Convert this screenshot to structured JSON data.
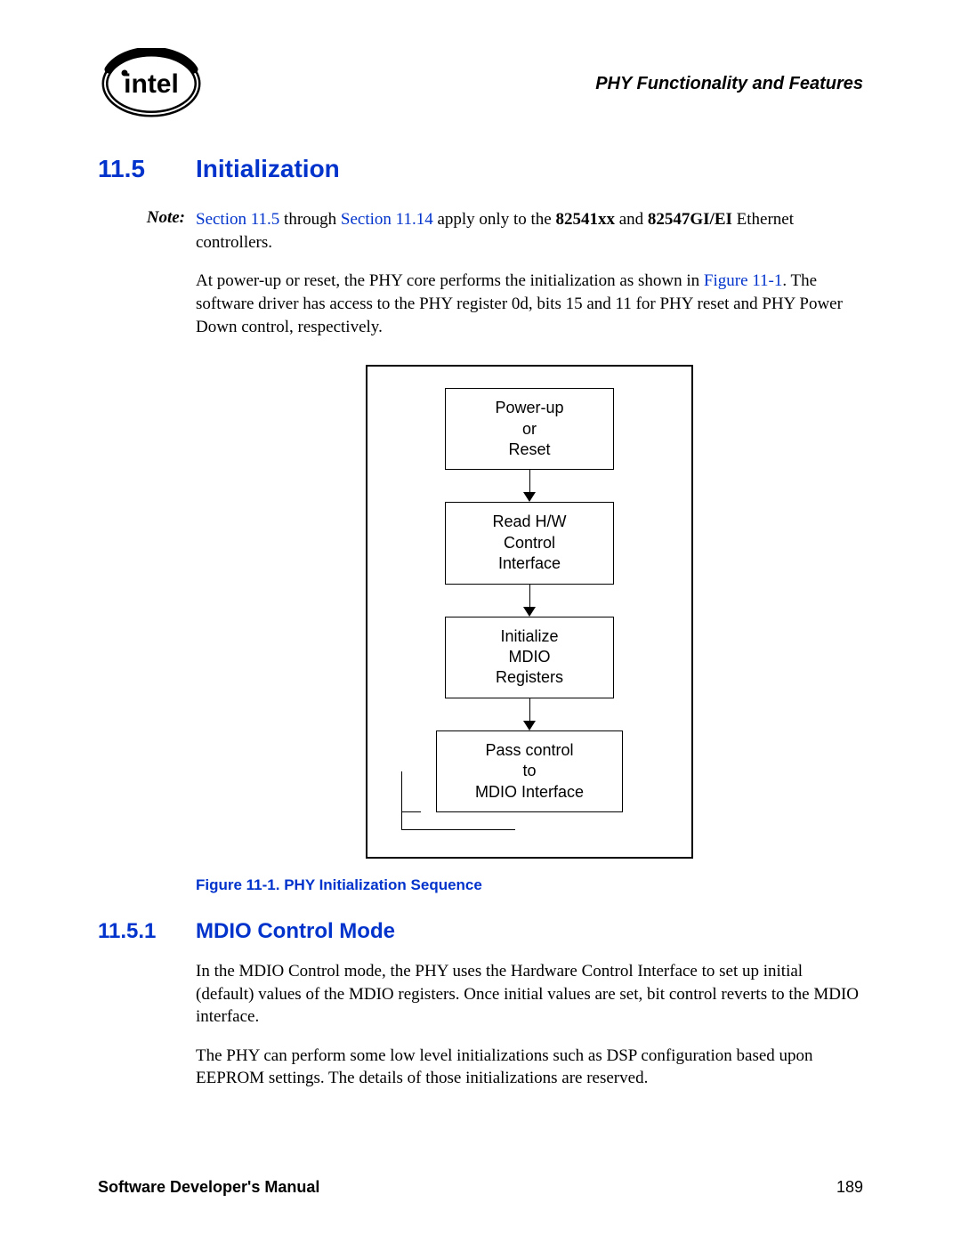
{
  "header": {
    "chapter_title": "PHY Functionality and Features"
  },
  "section": {
    "number": "11.5",
    "title": "Initialization"
  },
  "note": {
    "label": "Note:",
    "link1": "Section 11.5",
    "mid1": " through ",
    "link2": "Section 11.14",
    "mid2": " apply only to the ",
    "bold1": "82541xx",
    "mid3": " and ",
    "bold2": "82547GI/EI",
    "tail": " Ethernet controllers."
  },
  "para1": {
    "pre": "At power-up or reset, the PHY core performs the initialization as shown in ",
    "link": "Figure 11-1",
    "post": ". The software driver has access to the PHY register 0d, bits 15 and 11 for PHY reset and PHY Power Down control, respectively."
  },
  "figure": {
    "box1_l1": "Power-up",
    "box1_l2": "or",
    "box1_l3": "Reset",
    "box2_l1": "Read H/W",
    "box2_l2": "Control",
    "box2_l3": "Interface",
    "box3_l1": "Initialize",
    "box3_l2": "MDIO",
    "box3_l3": "Registers",
    "box4_l1": "Pass control",
    "box4_l2": "to",
    "box4_l3": "MDIO Interface",
    "caption": "Figure 11-1. PHY Initialization Sequence"
  },
  "subsection": {
    "number": "11.5.1",
    "title": "MDIO Control Mode"
  },
  "para2": "In the MDIO Control mode, the PHY uses the Hardware Control Interface to set up initial (default) values of the MDIO registers. Once initial values are set, bit control reverts to the MDIO interface.",
  "para3": "The PHY can perform some low level initializations such as DSP configuration based upon EEPROM settings. The details of those initializations are reserved.",
  "footer": {
    "manual": "Software Developer's Manual",
    "page": "189"
  }
}
